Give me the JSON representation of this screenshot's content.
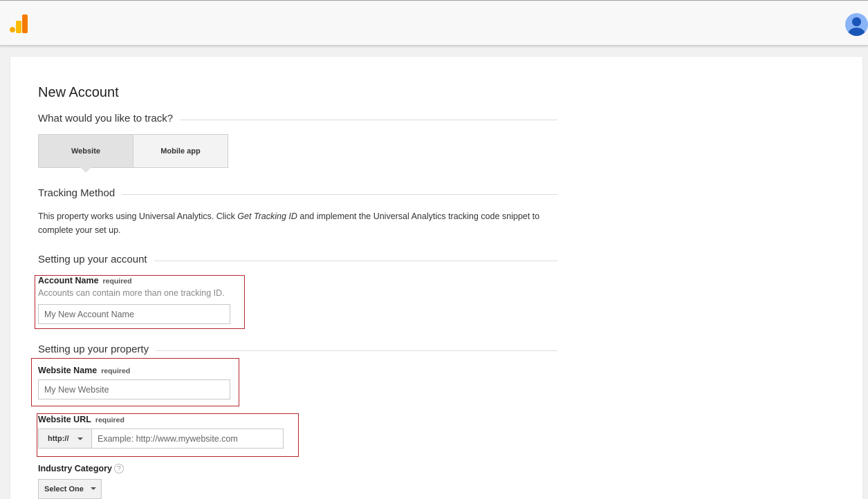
{
  "header": {
    "logo_icon": "analytics-bars-icon",
    "avatar_icon": "user-avatar-icon"
  },
  "page": {
    "title": "New Account",
    "track_section": "What would you like to track?",
    "tabs": [
      {
        "label": "Website",
        "active": true
      },
      {
        "label": "Mobile app",
        "active": false
      }
    ],
    "tracking_section": "Tracking Method",
    "tracking_text_before": "This property works using Universal Analytics. Click ",
    "tracking_text_italic": "Get Tracking ID",
    "tracking_text_after": " and implement the Universal Analytics tracking code snippet to complete your set up.",
    "account_section": "Setting up your account",
    "property_section": "Setting up your property"
  },
  "account_name": {
    "label": "Account Name",
    "required": "required",
    "hint": "Accounts can contain more than one tracking ID.",
    "placeholder": "My New Account Name",
    "value": ""
  },
  "website_name": {
    "label": "Website Name",
    "required": "required",
    "placeholder": "My New Website",
    "value": ""
  },
  "website_url": {
    "label": "Website URL",
    "required": "required",
    "protocol": "http://",
    "placeholder": "Example: http://www.mywebsite.com",
    "value": ""
  },
  "industry": {
    "label": "Industry Category",
    "help": "?",
    "selected": "Select One"
  },
  "colors": {
    "highlight_border": "#b5262e",
    "logo_orange": "#f57c00",
    "logo_yellow": "#fbbc04",
    "avatar_blue": "#1a56b8"
  }
}
